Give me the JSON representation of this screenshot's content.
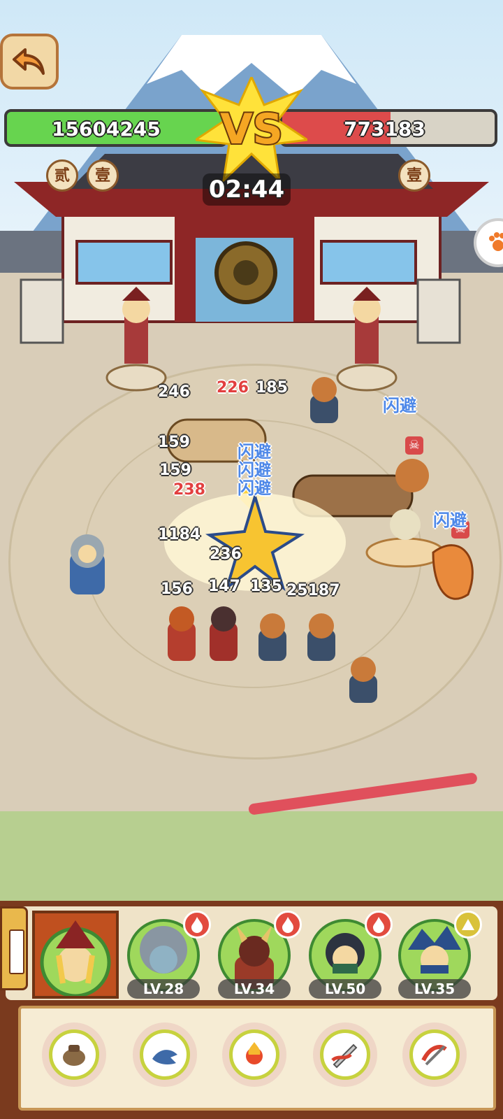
{
  "hud": {
    "left_power": "15604245",
    "right_power": "773183",
    "left_hp_fraction": 1.0,
    "right_hp_fraction": 0.51,
    "vs_label": "VS",
    "timer": "02:44",
    "left_badges": [
      "贰",
      "壹"
    ],
    "right_badges": [
      "壹"
    ]
  },
  "battle": {
    "damage_numbers": [
      "246",
      "226",
      "185",
      "159",
      "159",
      "238",
      "1184",
      "236",
      "156",
      "147",
      "135",
      "25187"
    ],
    "red_damage": [
      "226",
      "238"
    ],
    "dodge_label": "闪避"
  },
  "heroes": [
    {
      "name": "leader-samurai",
      "level": ""
    },
    {
      "name": "shark-hood",
      "level": "LV.28",
      "badge": "fire"
    },
    {
      "name": "horned-oni",
      "level": "LV.34",
      "badge": "fire"
    },
    {
      "name": "ninja-girl",
      "level": "LV.50",
      "badge": "fire"
    },
    {
      "name": "blue-hair-ninja",
      "level": "LV.35",
      "badge": "up"
    }
  ],
  "skills": [
    "sack-skill",
    "shark-skill",
    "fire-skill",
    "blade-skill",
    "slash-skill"
  ],
  "colors": {
    "hp_green": "#67d44f",
    "hp_red": "#dd4b4b",
    "dodge_blue": "#4e88e8",
    "panel_brown": "#7a3a1e"
  }
}
